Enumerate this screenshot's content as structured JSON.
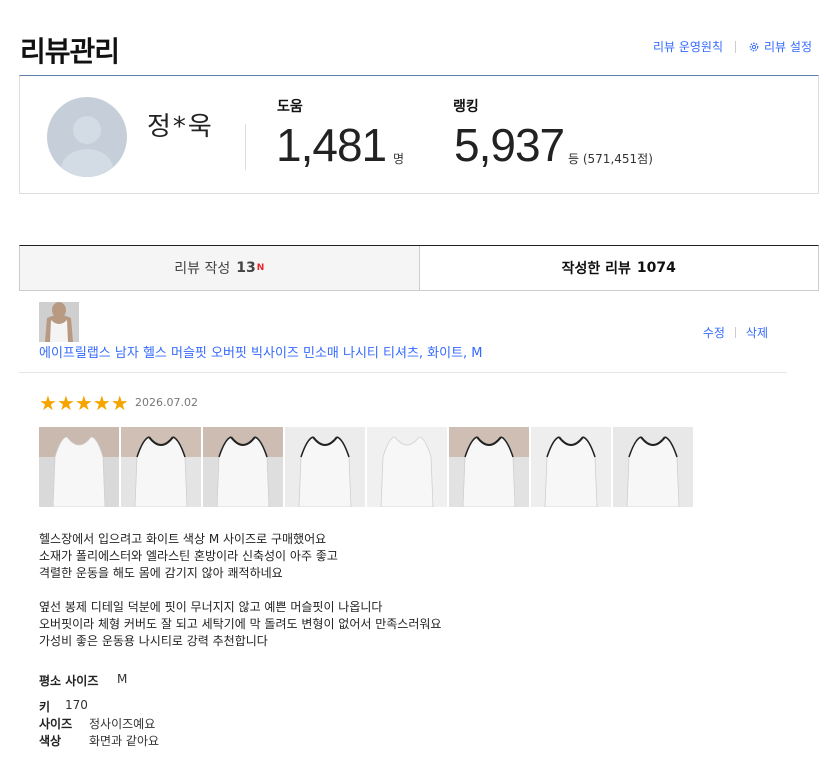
{
  "header": {
    "title": "리뷰관리",
    "policy_link": "리뷰 운영원칙",
    "settings_link": "리뷰 설정"
  },
  "profile": {
    "name": "정*욱",
    "help_label": "도움",
    "help_value": "1,481",
    "help_unit": "명",
    "rank_label": "랭킹",
    "rank_value": "5,937",
    "rank_unit": "등 (571,451점)"
  },
  "tabs": [
    {
      "label": "리뷰 작성",
      "count": "13",
      "badge": "N"
    },
    {
      "label": "작성한 리뷰",
      "count": "1074"
    }
  ],
  "review": {
    "product_name": "에이프릴랩스 남자 헬스 머슬핏 오버핏 빅사이즈 민소매 나시티 티셔츠, 화이트, M",
    "edit_label": "수정",
    "delete_label": "삭제",
    "rating": 5,
    "date": "2026.07.02",
    "photo_count": 8,
    "text_lines": [
      "헬스장에서 입으려고 화이트 색상 M 사이즈로 구매했어요",
      "소재가 폴리에스터와 엘라스틴 혼방이라 신축성이 아주 좋고",
      "격렬한 운동을 해도 몸에 감기지 않아 쾌적하네요",
      "",
      "옆선 봉제 디테일 덕분에 핏이 무너지지 않고 예쁜 머슬핏이 나옵니다",
      "오버핏이라 체형 커버도 잘 되고 세탁기에 막 돌려도 변형이 없어서 만족스러워요",
      "가성비 좋은 운동용 나시티로 강력 추천합니다"
    ],
    "survey": {
      "usual_size_label": "평소 사이즈",
      "usual_size_value": "M",
      "height_label": "키",
      "height_value": "170",
      "size_label": "사이즈",
      "size_value": "정사이즈예요",
      "color_label": "색상",
      "color_value": "화면과 같아요"
    }
  },
  "colors": {
    "accent": "#346aff",
    "star": "#f6a500",
    "badge": "#e52528"
  }
}
